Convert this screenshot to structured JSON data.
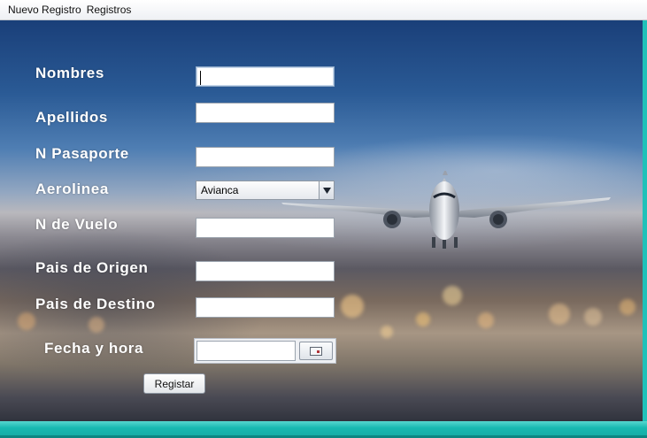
{
  "menu": {
    "items": [
      "Nuevo Registro",
      "Registros"
    ]
  },
  "form": {
    "fields": [
      {
        "label": "Nombres",
        "value": ""
      },
      {
        "label": "Apellidos",
        "value": ""
      },
      {
        "label": "N Pasaporte",
        "value": ""
      },
      {
        "label": "Aerolinea",
        "value": "Avianca"
      },
      {
        "label": "N de Vuelo",
        "value": ""
      },
      {
        "label": "Pais de Origen",
        "value": ""
      },
      {
        "label": "Pais de Destino",
        "value": ""
      },
      {
        "label": "Fecha y hora",
        "value": ""
      }
    ],
    "submit_label": "Registar"
  },
  "icons": {
    "select_arrow": "triangle-down-icon",
    "calendar": "calendar-icon"
  },
  "colors": {
    "window_frame": "#1fc1b9",
    "label_text": "#ffffff"
  }
}
